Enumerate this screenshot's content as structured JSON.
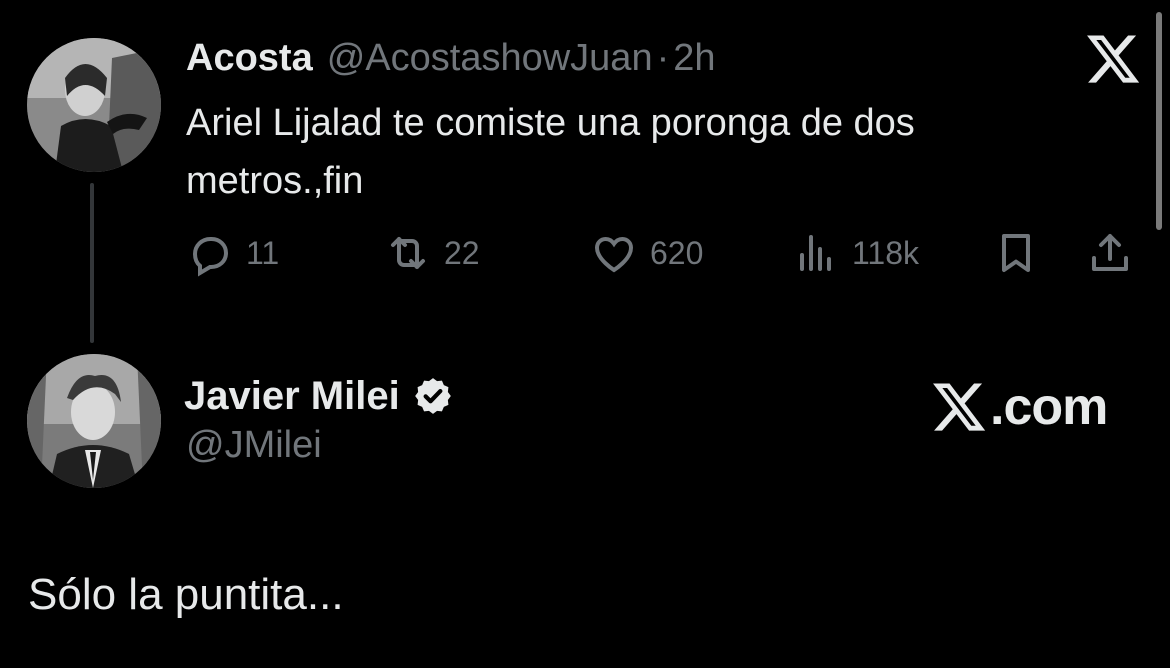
{
  "parent_tweet": {
    "display_name": "Acosta",
    "handle": "@AcostashowJuan",
    "separator": "·",
    "time": "2h",
    "text": "Ariel Lijalad te comiste una poronga de dos metros.,fin",
    "actions": {
      "replies": "11",
      "reposts": "22",
      "likes": "620",
      "views": "118k"
    }
  },
  "reply_tweet": {
    "display_name": "Javier Milei",
    "handle": "@JMilei",
    "verified": true,
    "text": "Sólo la puntita..."
  },
  "watermark": {
    "domain_text": ".com"
  },
  "colors": {
    "background": "#000000",
    "primary_text": "#e7e9ea",
    "secondary_text": "#71767b",
    "thread_line": "#333639"
  },
  "icons": [
    "x-logo-icon",
    "reply-icon",
    "repost-icon",
    "like-icon",
    "views-icon",
    "bookmark-icon",
    "share-icon",
    "verified-badge-icon"
  ]
}
